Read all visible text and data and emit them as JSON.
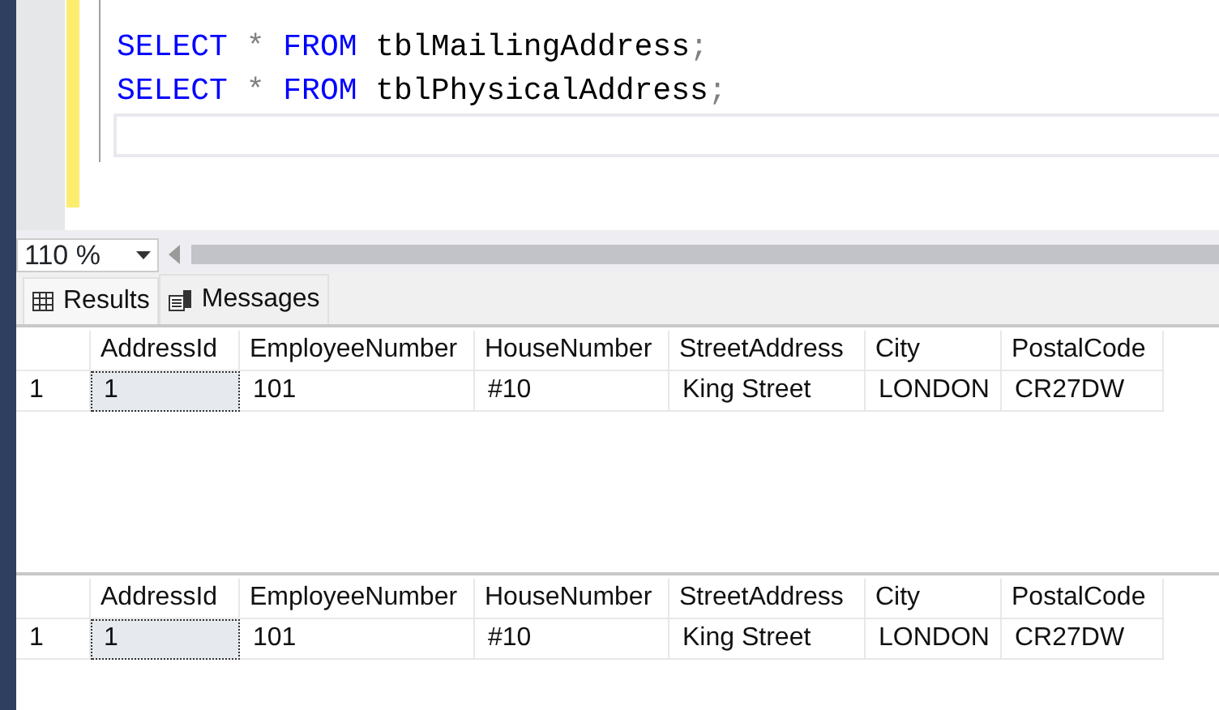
{
  "editor": {
    "lines": [
      {
        "tokens": [
          {
            "kind": "keyword",
            "text": "SELECT"
          },
          {
            "kind": "operator",
            "text": "*"
          },
          {
            "kind": "keyword",
            "text": "FROM"
          },
          {
            "kind": "identifier",
            "text": "tblMailingAddress"
          },
          {
            "kind": "operator",
            "text": ";"
          }
        ]
      },
      {
        "tokens": [
          {
            "kind": "keyword",
            "text": "SELECT"
          },
          {
            "kind": "operator",
            "text": "*"
          },
          {
            "kind": "keyword",
            "text": "FROM"
          },
          {
            "kind": "identifier",
            "text": "tblPhysicalAddress"
          },
          {
            "kind": "operator",
            "text": ";"
          }
        ]
      },
      {
        "current": true
      }
    ]
  },
  "zoom": {
    "value": "110 %"
  },
  "tabs": [
    {
      "label": "Results",
      "kind": "grid",
      "selected": true
    },
    {
      "label": "Messages",
      "kind": "messages",
      "selected": false
    }
  ],
  "grids": [
    {
      "columns": [
        "AddressId",
        "EmployeeNumber",
        "HouseNumber",
        "StreetAddress",
        "City",
        "PostalCode"
      ],
      "rows": [
        {
          "row_number": "1",
          "cells": [
            {
              "text": "1",
              "selected": true
            },
            {
              "text": "101",
              "selected": false
            },
            {
              "text": "#10",
              "selected": false
            },
            {
              "text": "King Street",
              "selected": false
            },
            {
              "text": "LONDON",
              "selected": false
            },
            {
              "text": "CR27DW",
              "selected": false
            }
          ]
        }
      ]
    },
    {
      "columns": [
        "AddressId",
        "EmployeeNumber",
        "HouseNumber",
        "StreetAddress",
        "City",
        "PostalCode"
      ],
      "rows": [
        {
          "row_number": "1",
          "cells": [
            {
              "text": "1",
              "selected": true
            },
            {
              "text": "101",
              "selected": false
            },
            {
              "text": "#10",
              "selected": false
            },
            {
              "text": "King Street",
              "selected": false
            },
            {
              "text": "LONDON",
              "selected": false
            },
            {
              "text": "CR27DW",
              "selected": false
            }
          ]
        }
      ]
    }
  ]
}
